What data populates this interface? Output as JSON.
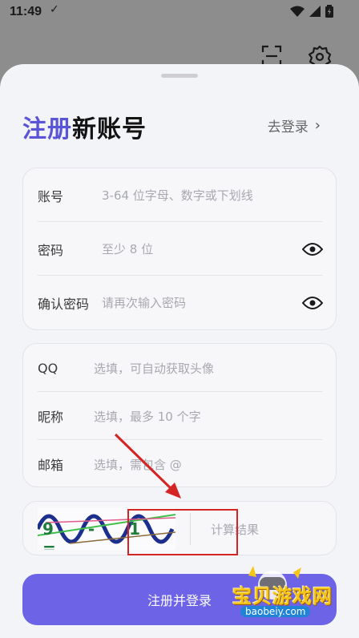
{
  "status_bar": {
    "time": "11:49",
    "check_icon": "✓"
  },
  "top_icons": [
    "scan-icon",
    "gear-icon"
  ],
  "header": {
    "title_accent": "注册",
    "title_rest": "新账号",
    "go_login": "去登录",
    "chevron": "›"
  },
  "account_card": {
    "account_label": "账号",
    "account_placeholder": "3-64 位字母、数字或下划线",
    "password_label": "密码",
    "password_placeholder": "至少 8 位",
    "confirm_label": "确认密码",
    "confirm_placeholder": "请再次输入密码"
  },
  "profile_card": {
    "qq_label": "QQ",
    "qq_placeholder": "选填，可自动获取头像",
    "nickname_label": "昵称",
    "nickname_placeholder": "选填，最多 10 个字",
    "email_label": "邮箱",
    "email_placeholder": "选填，需包含 @"
  },
  "captcha": {
    "image_text": "9 - 1 =",
    "result_placeholder": "计算结果"
  },
  "register_button": "注册并登录",
  "watermark": {
    "text": "宝贝游戏网",
    "url": "baobeiy.com"
  },
  "colors": {
    "accent": "#5a55d6",
    "button": "#6c63e6",
    "highlight": "#d42424"
  }
}
